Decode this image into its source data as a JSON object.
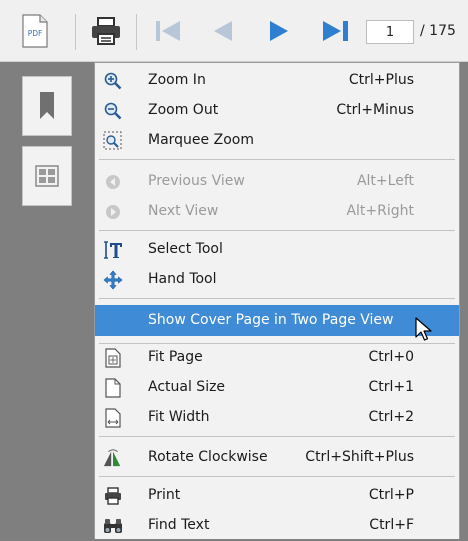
{
  "toolbar": {
    "pdf_icon_text": "PDF",
    "current_page": "1",
    "total_pages": "/ 175",
    "icons": [
      "pdf-icon",
      "printer-icon",
      "first-page-icon",
      "previous-page-icon",
      "next-page-icon",
      "last-page-icon"
    ]
  },
  "left_panel": {
    "icons": [
      "bookmark-icon",
      "thumbnails-icon"
    ]
  },
  "menu": {
    "items": [
      {
        "label": "Zoom In",
        "shortcut": "Ctrl+Plus",
        "icon": "zoom-in-icon"
      },
      {
        "label": "Zoom Out",
        "shortcut": "Ctrl+Minus",
        "icon": "zoom-out-icon"
      },
      {
        "label": "Marquee Zoom",
        "shortcut": "",
        "icon": "marquee-zoom-icon"
      },
      {
        "label": "Previous View",
        "shortcut": "Alt+Left",
        "icon": "previous-view-icon",
        "disabled": true
      },
      {
        "label": "Next View",
        "shortcut": "Alt+Right",
        "icon": "next-view-icon",
        "disabled": true
      },
      {
        "label": "Select Tool",
        "shortcut": "",
        "icon": "select-tool-icon"
      },
      {
        "label": "Hand Tool",
        "shortcut": "",
        "icon": "hand-tool-icon"
      },
      {
        "label": "Show Cover Page in Two Page View",
        "shortcut": "",
        "icon": "",
        "highlighted": true
      },
      {
        "label": "Fit Page",
        "shortcut": "Ctrl+0",
        "icon": "fit-page-icon"
      },
      {
        "label": "Actual Size",
        "shortcut": "Ctrl+1",
        "icon": "actual-size-icon"
      },
      {
        "label": "Fit Width",
        "shortcut": "Ctrl+2",
        "icon": "fit-width-icon"
      },
      {
        "label": "Rotate Clockwise",
        "shortcut": "Ctrl+Shift+Plus",
        "icon": "rotate-clockwise-icon"
      },
      {
        "label": "Print",
        "shortcut": "Ctrl+P",
        "icon": "print-icon"
      },
      {
        "label": "Find Text",
        "shortcut": "Ctrl+F",
        "icon": "find-text-icon"
      }
    ]
  },
  "colors": {
    "highlight": "#3f8bd6",
    "nav_arrow": "#2f7fd0",
    "disabled_text": "#9a9a9a"
  }
}
